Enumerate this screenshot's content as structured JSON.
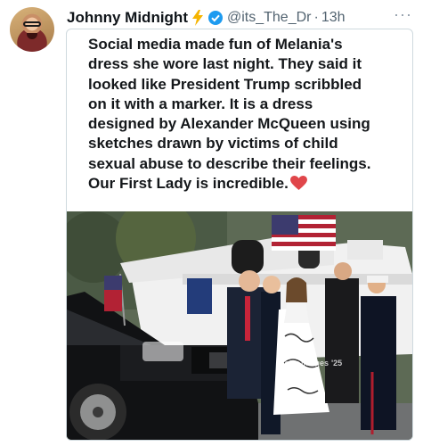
{
  "tweet": {
    "display_name": "Johnny Midnight",
    "handle": "@its_The_Dr",
    "separator": "·",
    "timestamp": "13h",
    "more_label": "···",
    "icons": [
      "lightning-bolt-icon",
      "verified-badge-icon",
      "more-options-icon"
    ],
    "colors": {
      "bolt": "#f5b400",
      "verified": "#1d9bf0",
      "heart": "#e0464a"
    }
  },
  "media": {
    "text_lines": [
      "Social media made fun of Melania's",
      "dress she wore last night. They said it",
      "looked like President Trump scribbled",
      "on it with a marker. It is a dress",
      "designed by Alexander McQueen using",
      "sketches drawn by victims of child",
      "sexual abuse to describe their feelings.",
      "Our First Lady is incredible."
    ],
    "watermark": "getty images",
    "watermark_year": "'25"
  }
}
